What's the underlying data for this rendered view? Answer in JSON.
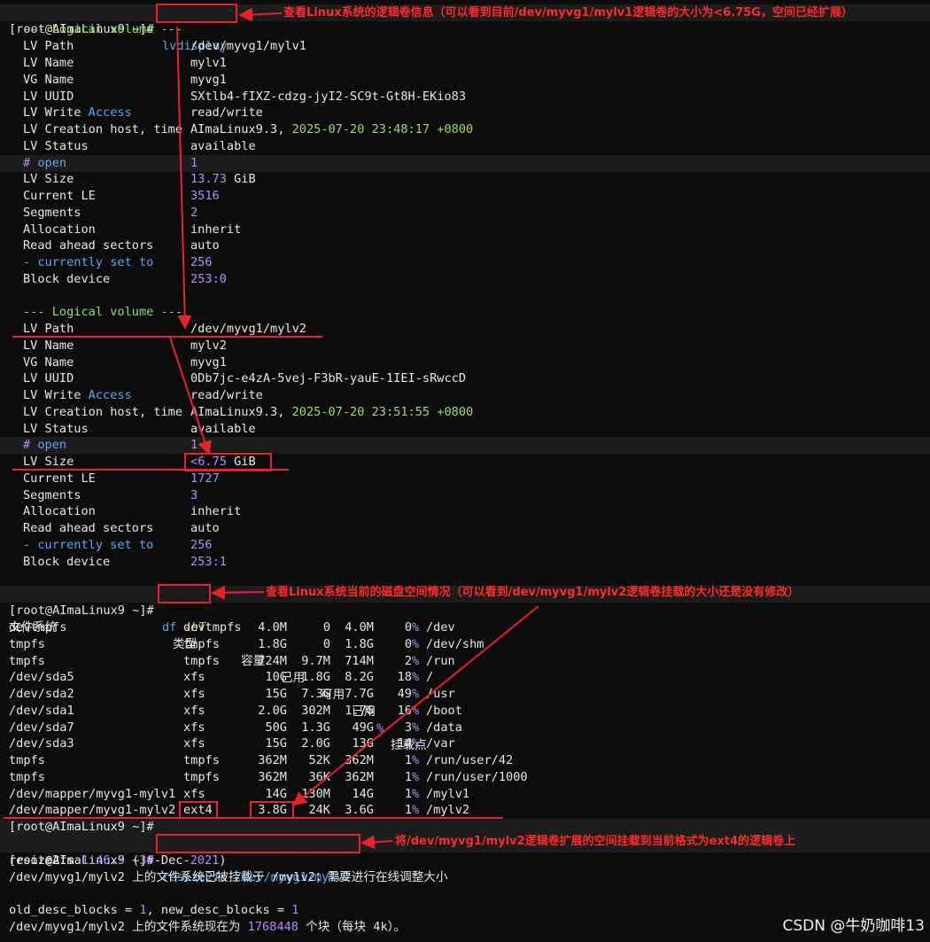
{
  "prompt": "[root@AImaLinux9 ~]#",
  "lv_header": "--- Logical volume ---",
  "labels": {
    "path": "LV Path",
    "name": "LV Name",
    "vg": "VG Name",
    "uuid": "LV UUID",
    "access_pre": "LV Write ",
    "access_kw": "Access",
    "creation": "LV Creation host, time",
    "status": "LV Status",
    "open_hash": "# ",
    "open_kw": "open",
    "size": "LV Size",
    "le": "Current LE",
    "segments": "Segments",
    "allocation": "Allocation",
    "readahead": "Read ahead sectors",
    "currently_dash": "- ",
    "currently": "currently set to",
    "block": "Block device"
  },
  "commands": {
    "lvdisplay": "lvdisplay",
    "df": "df ",
    "df_flag": "-hT",
    "resize": "resize2fs /dev/myvg1/mylv2"
  },
  "lv1": {
    "path": "/dev/myvg1/mylv1",
    "name": "mylv1",
    "vg": "myvg1",
    "uuid": "SXtlb4-fIXZ-cdzg-jyI2-SC9t-Gt8H-EKio83",
    "access": "read/write",
    "creation_host": "AImaLinux9.3, ",
    "creation_time": "2025-07-20 23:48:17 +0800",
    "status": "available",
    "open": "1",
    "size_num": "13.73",
    "size_unit": " GiB",
    "le": "3516",
    "segments": "2",
    "allocation": "inherit",
    "readahead": "auto",
    "currently": "256",
    "block_major": "253",
    "block_sep": ":",
    "block_minor": "0"
  },
  "lv2": {
    "path": "/dev/myvg1/mylv2",
    "name": "mylv2",
    "vg": "myvg1",
    "uuid": "0Db7jc-e4zA-5vej-F3bR-yauE-1IEI-sRwccD",
    "access": "read/write",
    "creation_host": "AImaLinux9.3, ",
    "creation_time": "2025-07-20 23:51:55 +0800",
    "status": "available",
    "open": "1",
    "size_prefix": "<",
    "size_num": "6.75",
    "size_unit": " GiB",
    "le": "1727",
    "segments": "3",
    "allocation": "inherit",
    "readahead": "auto",
    "currently": "256",
    "block_major": "253",
    "block_sep": ":",
    "block_minor": "1"
  },
  "df": {
    "headers": [
      "文件系统",
      "类型",
      "容量",
      "已用",
      "可用",
      "已用",
      "%",
      "挂载点"
    ],
    "rows": [
      [
        "devtmpfs",
        "devtmpfs",
        "4.0M",
        "0",
        "4.0M",
        "0",
        "/dev"
      ],
      [
        "tmpfs",
        "tmpfs",
        "1.8G",
        "0",
        "1.8G",
        "0",
        "/dev/shm"
      ],
      [
        "tmpfs",
        "tmpfs",
        "724M",
        "9.7M",
        "714M",
        "2",
        "/run"
      ],
      [
        "/dev/sda5",
        "xfs",
        "10G",
        "1.8G",
        "8.2G",
        "18",
        "/"
      ],
      [
        "/dev/sda2",
        "xfs",
        "15G",
        "7.3G",
        "7.7G",
        "49",
        "/usr"
      ],
      [
        "/dev/sda1",
        "xfs",
        "2.0G",
        "302M",
        "1.7G",
        "16",
        "/boot"
      ],
      [
        "/dev/sda7",
        "xfs",
        "50G",
        "1.3G",
        "49G",
        "3",
        "/data"
      ],
      [
        "/dev/sda3",
        "xfs",
        "15G",
        "2.0G",
        "13G",
        "14",
        "/var"
      ],
      [
        "tmpfs",
        "tmpfs",
        "362M",
        "52K",
        "362M",
        "1",
        "/run/user/42"
      ],
      [
        "tmpfs",
        "tmpfs",
        "362M",
        "36K",
        "362M",
        "1",
        "/run/user/1000"
      ],
      [
        "/dev/mapper/myvg1-mylv1",
        "xfs",
        "14G",
        "130M",
        "14G",
        "1",
        "/mylv1"
      ],
      [
        "/dev/mapper/myvg1-mylv2",
        "ext4",
        "3.8G",
        "24K",
        "3.6G",
        "1",
        "/mylv2"
      ]
    ],
    "percent_sign": "%"
  },
  "resize_output": {
    "l1_pre": "resize2fs ",
    "l1_ver": "1.46.5",
    "l1_mid": " (",
    "l1_num": "30",
    "l1_dash": "-Dec-",
    "l1_year": "2021",
    "l1_end": ")",
    "l2": "/dev/myvg1/mylv2 上的文件系统已被挂载于 /mylv2；需要进行在线调整大小",
    "l3_a": "old_desc_blocks = ",
    "l3_b": "1",
    "l3_c": ", new_desc_blocks = ",
    "l3_d": "1",
    "l4_a": "/dev/myvg1/mylv2 上的文件系统现在为 ",
    "l4_b": "1768448",
    "l4_c": " 个块（每块 4k）。"
  },
  "annotations": {
    "lvdisplay": "查看Linux系统的逻辑卷信息（可以看到目前/dev/myvg1/mylv1逻辑卷的大小为<6.75G，空间已经扩展）",
    "df": "查看Linux系统当前的磁盘空间情况（可以看到/dev/myvg1/mylv2逻辑卷挂载的大小还是没有修改）",
    "resize": "将/dev/myvg1/mylv2逻辑卷扩展的空间挂载到当前格式为ext4的逻辑卷上"
  },
  "watermark": "CSDN @牛奶咖啡13",
  "colors": {
    "annotation": "#ff2a2a",
    "box": "#e8222a",
    "blue": "#5aa7f2",
    "purple": "#b68aff",
    "green": "#9fd86a"
  }
}
